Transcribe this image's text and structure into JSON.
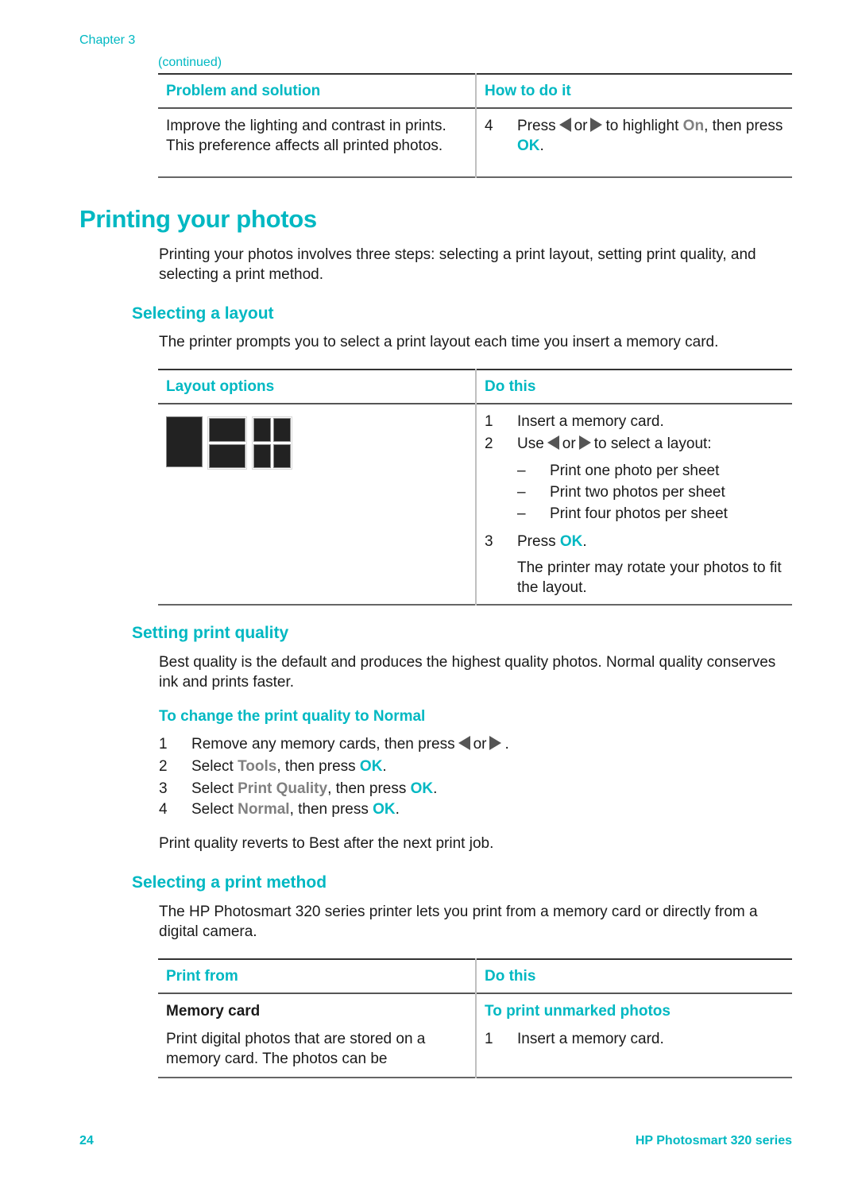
{
  "header": {
    "chapter": "Chapter 3",
    "continued": "(continued)"
  },
  "colors": {
    "accent": "#00b8c2",
    "highlight_gray": "#808080",
    "text": "#1a1a1a"
  },
  "table1": {
    "headers": [
      "Problem and solution",
      "How to do it"
    ],
    "row": {
      "problem": "Improve the lighting and contrast in prints. This preference affects all printed photos.",
      "step_num": "4",
      "step_pre": "Press",
      "step_or": "or",
      "step_mid": "to highlight",
      "step_on": "On",
      "step_then": ", then press",
      "step_ok": "OK",
      "step_end": "."
    }
  },
  "section": {
    "title": "Printing your photos",
    "intro": "Printing your photos involves three steps: selecting a print layout, setting print quality, and selecting a print method."
  },
  "layout": {
    "title": "Selecting a layout",
    "intro": "The printer prompts you to select a print layout each time you insert a memory card.",
    "table": {
      "headers": [
        "Layout options",
        "Do this"
      ],
      "icons": [
        "layout-one-photo-icon",
        "layout-two-photos-icon",
        "layout-four-photos-icon"
      ],
      "steps": [
        {
          "n": "1",
          "text": "Insert a memory card."
        },
        {
          "n": "2",
          "pre": "Use",
          "or": "or",
          "post": "to select a layout:"
        },
        {
          "n": "3",
          "pre": "Press",
          "ok": "OK",
          "post": "."
        }
      ],
      "options": [
        "Print one photo per sheet",
        "Print two photos per sheet",
        "Print four photos per sheet"
      ],
      "dash": "–",
      "note": "The printer may rotate your photos to fit the layout."
    }
  },
  "quality": {
    "title": "Setting print quality",
    "intro": "Best quality is the default and produces the highest quality photos. Normal quality conserves ink and prints faster.",
    "procedure_title": "To change the print quality to Normal",
    "steps": [
      {
        "n": "1",
        "pre": "Remove any memory cards, then press",
        "or": "or",
        "post": "."
      },
      {
        "n": "2",
        "pre": "Select",
        "hl": "Tools",
        "mid": ", then press",
        "ok": "OK",
        "post": "."
      },
      {
        "n": "3",
        "pre": "Select",
        "hl": "Print Quality",
        "mid": ", then press",
        "ok": "OK",
        "post": "."
      },
      {
        "n": "4",
        "pre": "Select",
        "hl": "Normal",
        "mid": ", then press",
        "ok": "OK",
        "post": "."
      }
    ],
    "note": "Print quality reverts to Best after the next print job."
  },
  "method": {
    "title": "Selecting a print method",
    "intro": "The HP Photosmart 320 series printer lets you print from a memory card or directly from a digital camera.",
    "table": {
      "headers": [
        "Print from",
        "Do this"
      ],
      "source_title": "Memory card",
      "source_desc": "Print digital photos that are stored on a memory card. The photos can be",
      "proc_title": "To print unmarked photos",
      "steps": [
        {
          "n": "1",
          "text": "Insert a memory card."
        }
      ]
    }
  },
  "footer": {
    "page_number": "24",
    "product": "HP Photosmart 320 series"
  }
}
